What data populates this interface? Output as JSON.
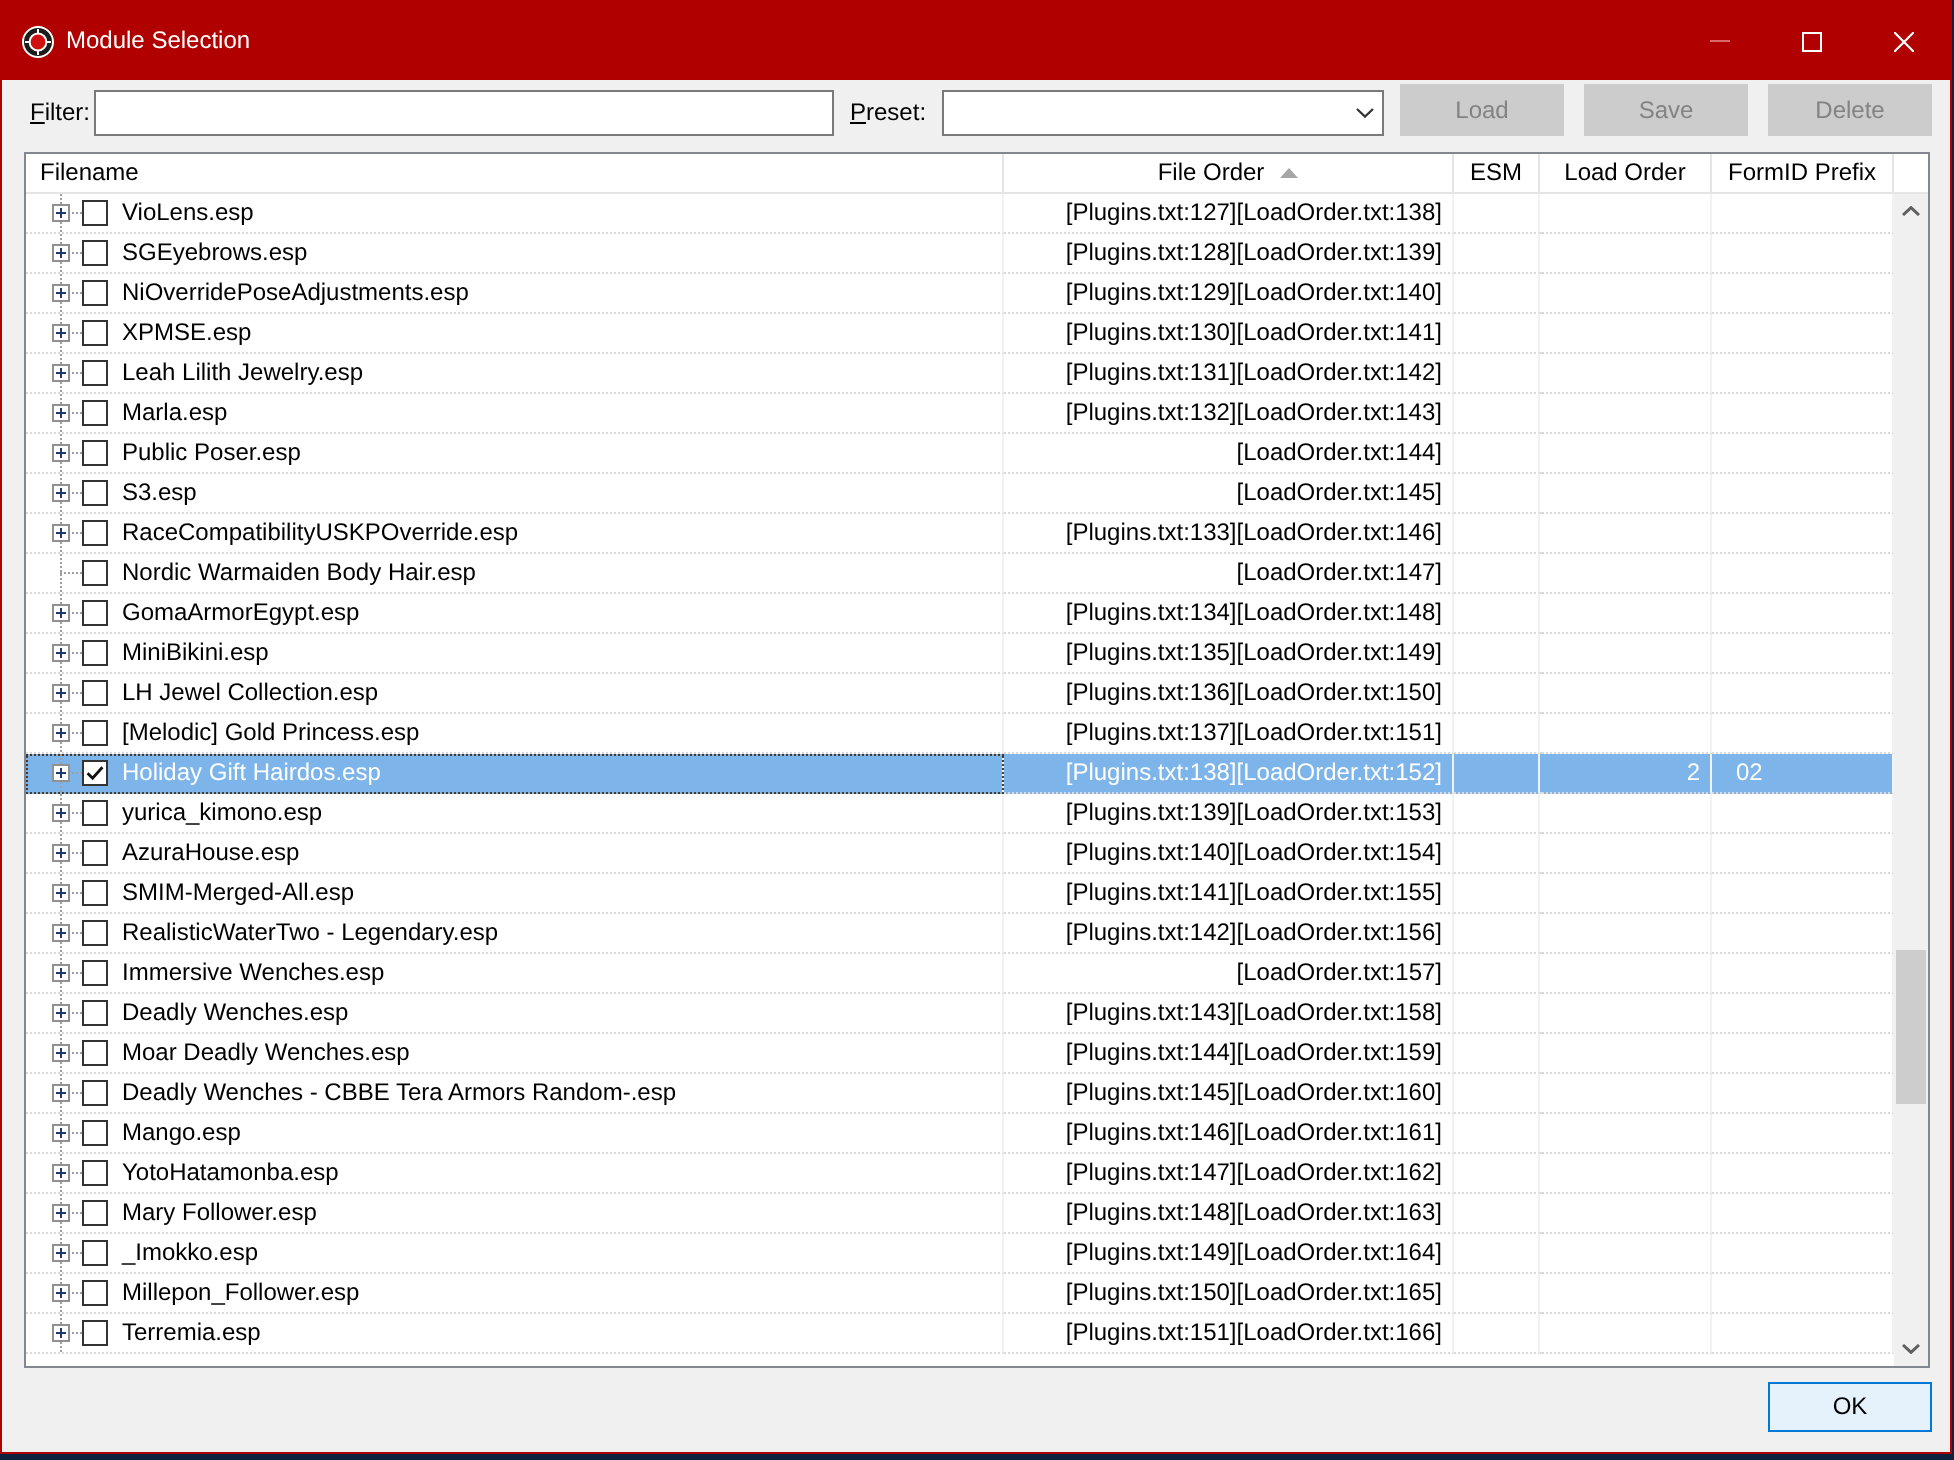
{
  "window": {
    "title": "Module Selection",
    "controls": [
      {
        "kind": "minimize",
        "disabled": true
      },
      {
        "kind": "maximize",
        "disabled": false
      },
      {
        "kind": "close",
        "disabled": false
      }
    ]
  },
  "toolbar": {
    "filter": {
      "label": "Filter:",
      "access_key_underlined": true
    },
    "preset": {
      "label": "Preset:",
      "access_key_underlined": true
    },
    "buttons": [
      {
        "label": "Load",
        "disabled": true
      },
      {
        "label": "Save",
        "disabled": true
      },
      {
        "label": "Delete",
        "disabled": true
      }
    ]
  },
  "table": {
    "columns": [
      {
        "label": "Filename",
        "sorted": false
      },
      {
        "label": "File Order",
        "sorted": true
      },
      {
        "label": "ESM",
        "sorted": false
      },
      {
        "label": "Load Order",
        "sorted": false
      },
      {
        "label": "FormID Prefix",
        "sorted": false
      }
    ],
    "rows": [
      {
        "filename": "VioLens.esp",
        "file_order": "[Plugins.txt:127][LoadOrder.txt:138]",
        "expandable": true,
        "checked": false,
        "selected": false
      },
      {
        "filename": "SGEyebrows.esp",
        "file_order": "[Plugins.txt:128][LoadOrder.txt:139]",
        "expandable": true,
        "checked": false,
        "selected": false
      },
      {
        "filename": "NiOverridePoseAdjustments.esp",
        "file_order": "[Plugins.txt:129][LoadOrder.txt:140]",
        "expandable": true,
        "checked": false,
        "selected": false
      },
      {
        "filename": "XPMSE.esp",
        "file_order": "[Plugins.txt:130][LoadOrder.txt:141]",
        "expandable": true,
        "checked": false,
        "selected": false
      },
      {
        "filename": "Leah Lilith Jewelry.esp",
        "file_order": "[Plugins.txt:131][LoadOrder.txt:142]",
        "expandable": true,
        "checked": false,
        "selected": false
      },
      {
        "filename": "Marla.esp",
        "file_order": "[Plugins.txt:132][LoadOrder.txt:143]",
        "expandable": true,
        "checked": false,
        "selected": false
      },
      {
        "filename": "Public Poser.esp",
        "file_order": "[LoadOrder.txt:144]",
        "expandable": true,
        "checked": false,
        "selected": false
      },
      {
        "filename": "S3.esp",
        "file_order": "[LoadOrder.txt:145]",
        "expandable": true,
        "checked": false,
        "selected": false
      },
      {
        "filename": "RaceCompatibilityUSKPOverride.esp",
        "file_order": "[Plugins.txt:133][LoadOrder.txt:146]",
        "expandable": true,
        "checked": false,
        "selected": false
      },
      {
        "filename": "Nordic Warmaiden Body Hair.esp",
        "file_order": "[LoadOrder.txt:147]",
        "expandable": false,
        "checked": false,
        "selected": false
      },
      {
        "filename": "GomaArmorEgypt.esp",
        "file_order": "[Plugins.txt:134][LoadOrder.txt:148]",
        "expandable": true,
        "checked": false,
        "selected": false
      },
      {
        "filename": "MiniBikini.esp",
        "file_order": "[Plugins.txt:135][LoadOrder.txt:149]",
        "expandable": true,
        "checked": false,
        "selected": false
      },
      {
        "filename": "LH Jewel Collection.esp",
        "file_order": "[Plugins.txt:136][LoadOrder.txt:150]",
        "expandable": true,
        "checked": false,
        "selected": false
      },
      {
        "filename": "[Melodic] Gold Princess.esp",
        "file_order": "[Plugins.txt:137][LoadOrder.txt:151]",
        "expandable": true,
        "checked": false,
        "selected": false
      },
      {
        "filename": "Holiday Gift Hairdos.esp",
        "file_order": "[Plugins.txt:138][LoadOrder.txt:152]",
        "load_order": "2",
        "formid_prefix": "02",
        "expandable": true,
        "checked": true,
        "selected": true
      },
      {
        "filename": "yurica_kimono.esp",
        "file_order": "[Plugins.txt:139][LoadOrder.txt:153]",
        "expandable": true,
        "checked": false,
        "selected": false
      },
      {
        "filename": "AzuraHouse.esp",
        "file_order": "[Plugins.txt:140][LoadOrder.txt:154]",
        "expandable": true,
        "checked": false,
        "selected": false
      },
      {
        "filename": "SMIM-Merged-All.esp",
        "file_order": "[Plugins.txt:141][LoadOrder.txt:155]",
        "expandable": true,
        "checked": false,
        "selected": false
      },
      {
        "filename": "RealisticWaterTwo - Legendary.esp",
        "file_order": "[Plugins.txt:142][LoadOrder.txt:156]",
        "expandable": true,
        "checked": false,
        "selected": false
      },
      {
        "filename": "Immersive Wenches.esp",
        "file_order": "[LoadOrder.txt:157]",
        "expandable": true,
        "checked": false,
        "selected": false
      },
      {
        "filename": "Deadly Wenches.esp",
        "file_order": "[Plugins.txt:143][LoadOrder.txt:158]",
        "expandable": true,
        "checked": false,
        "selected": false
      },
      {
        "filename": "Moar Deadly Wenches.esp",
        "file_order": "[Plugins.txt:144][LoadOrder.txt:159]",
        "expandable": true,
        "checked": false,
        "selected": false
      },
      {
        "filename": "Deadly Wenches - CBBE Tera Armors Random-.esp",
        "file_order": "[Plugins.txt:145][LoadOrder.txt:160]",
        "expandable": true,
        "checked": false,
        "selected": false
      },
      {
        "filename": "Mango.esp",
        "file_order": "[Plugins.txt:146][LoadOrder.txt:161]",
        "expandable": true,
        "checked": false,
        "selected": false
      },
      {
        "filename": "YotoHatamonba.esp",
        "file_order": "[Plugins.txt:147][LoadOrder.txt:162]",
        "expandable": true,
        "checked": false,
        "selected": false
      },
      {
        "filename": "Mary Follower.esp",
        "file_order": "[Plugins.txt:148][LoadOrder.txt:163]",
        "expandable": true,
        "checked": false,
        "selected": false
      },
      {
        "filename": "_Imokko.esp",
        "file_order": "[Plugins.txt:149][LoadOrder.txt:164]",
        "expandable": true,
        "checked": false,
        "selected": false
      },
      {
        "filename": "Millepon_Follower.esp",
        "file_order": "[Plugins.txt:150][LoadOrder.txt:165]",
        "expandable": true,
        "checked": false,
        "selected": false
      },
      {
        "filename": "Terremia.esp",
        "file_order": "[Plugins.txt:151][LoadOrder.txt:166]",
        "expandable": true,
        "checked": false,
        "selected": false
      }
    ]
  },
  "footer": {
    "buttons": [
      {
        "label": "OK",
        "default": true
      }
    ]
  }
}
